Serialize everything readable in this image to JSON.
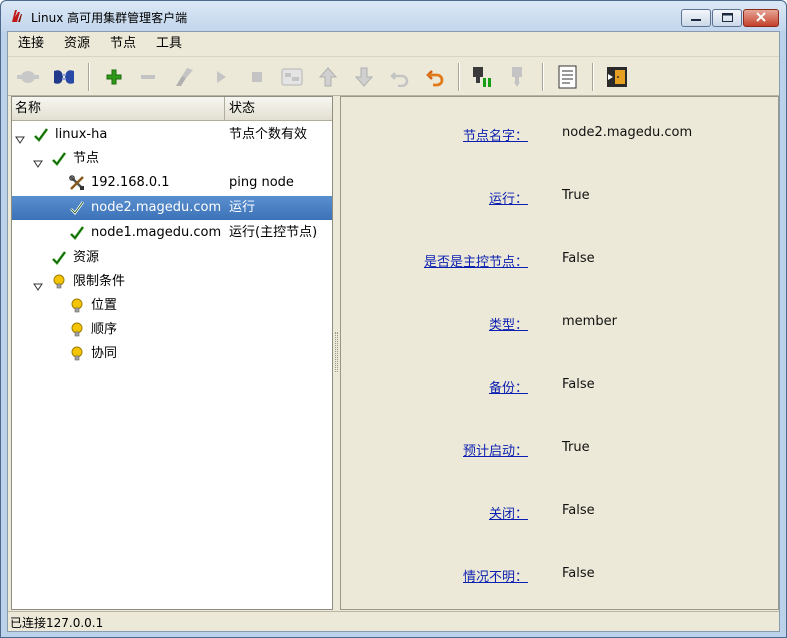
{
  "window": {
    "title": "Linux 高可用集群管理客户端"
  },
  "menu": [
    "连接",
    "资源",
    "节点",
    "工具"
  ],
  "toolbar": {
    "buttons": [
      {
        "icon": "disconnect-plug-icon",
        "enabled": false
      },
      {
        "icon": "connect-plug-icon",
        "enabled": true
      },
      {
        "icon": "add-icon",
        "enabled": true
      },
      {
        "icon": "remove-icon",
        "enabled": false
      },
      {
        "icon": "cleanup-brush-icon",
        "enabled": false
      },
      {
        "icon": "start-icon",
        "enabled": false
      },
      {
        "icon": "stop-icon",
        "enabled": false
      },
      {
        "icon": "default-icon",
        "enabled": false
      },
      {
        "icon": "move-up-icon",
        "enabled": false
      },
      {
        "icon": "move-down-icon",
        "enabled": false
      },
      {
        "icon": "undo-icon",
        "enabled": false
      },
      {
        "icon": "redo-icon",
        "enabled": true
      },
      {
        "icon": "standby-icon",
        "enabled": true
      },
      {
        "icon": "active-icon",
        "enabled": false
      },
      {
        "icon": "log-document-icon",
        "enabled": true
      },
      {
        "icon": "exit-icon",
        "enabled": true
      }
    ]
  },
  "tree": {
    "headers": {
      "name": "名称",
      "status": "状态"
    },
    "rows": [
      {
        "label": "linux-ha",
        "status": "节点个数有效",
        "icon": "check-icon",
        "expander": true
      },
      {
        "label": "节点",
        "status": "",
        "icon": "check-icon",
        "expander": true
      },
      {
        "label": "192.168.0.1",
        "status": "ping node",
        "icon": "tools-icon",
        "expander": false
      },
      {
        "label": "node2.magedu.com",
        "status": "运行",
        "icon": "check-icon",
        "expander": false
      },
      {
        "label": "node1.magedu.com",
        "status": "运行(主控节点)",
        "icon": "check-icon",
        "expander": false
      },
      {
        "label": "资源",
        "status": "",
        "icon": "check-icon",
        "expander": false
      },
      {
        "label": "限制条件",
        "status": "",
        "icon": "bulb-icon",
        "expander": true
      },
      {
        "label": "位置",
        "status": "",
        "icon": "bulb-icon",
        "expander": false
      },
      {
        "label": "顺序",
        "status": "",
        "icon": "bulb-icon",
        "expander": false
      },
      {
        "label": "协同",
        "status": "",
        "icon": "bulb-icon",
        "expander": false
      }
    ],
    "selected_index": 3
  },
  "details": [
    {
      "label": "节点名字：",
      "value": "node2.magedu.com"
    },
    {
      "label": "运行：",
      "value": "True"
    },
    {
      "label": "是否是主控节点：",
      "value": "False"
    },
    {
      "label": "类型：",
      "value": "member"
    },
    {
      "label": "备份：",
      "value": "False"
    },
    {
      "label": "预计启动：",
      "value": "True"
    },
    {
      "label": "关闭：",
      "value": "False"
    },
    {
      "label": "情况不明：",
      "value": "False"
    }
  ],
  "statusbar": {
    "text": "已连接127.0.0.1"
  },
  "colors": {
    "selection": "#3c72b8",
    "link": "#0b1fb0",
    "check": "#2f9a1a",
    "bulb": "#f2c500"
  }
}
